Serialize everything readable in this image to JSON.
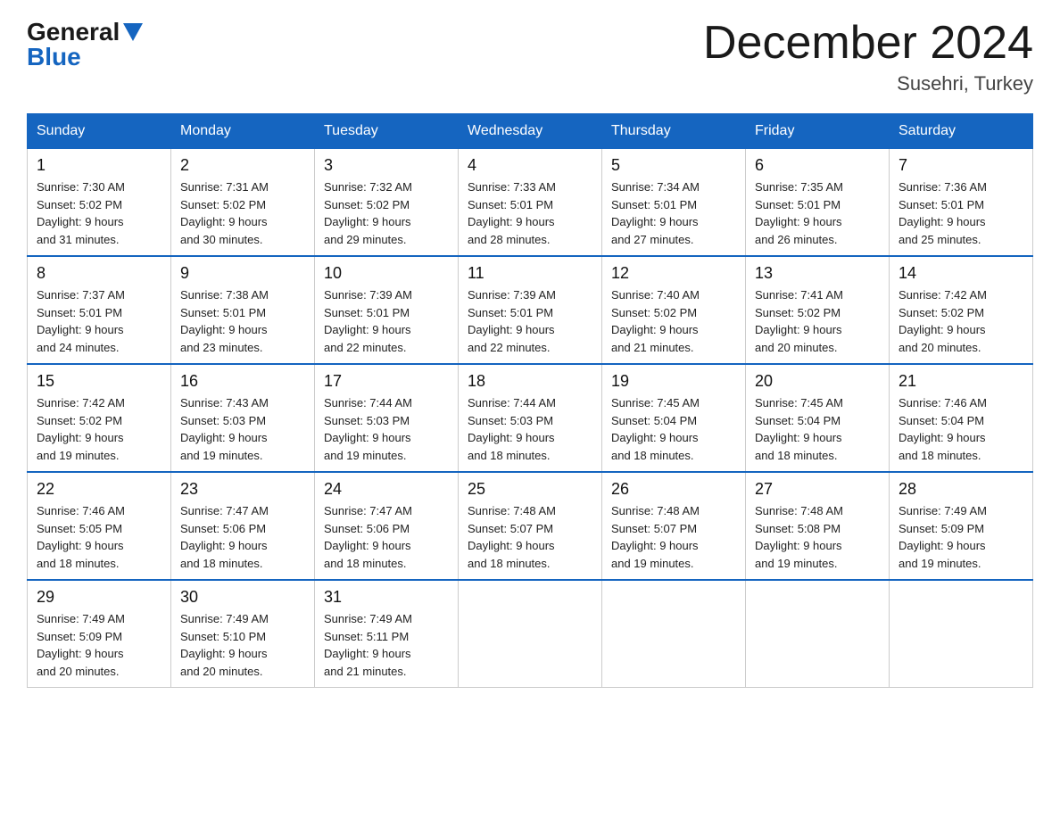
{
  "header": {
    "logo_general": "General",
    "logo_blue": "Blue",
    "month_title": "December 2024",
    "location": "Susehri, Turkey"
  },
  "days_of_week": [
    "Sunday",
    "Monday",
    "Tuesday",
    "Wednesday",
    "Thursday",
    "Friday",
    "Saturday"
  ],
  "weeks": [
    [
      {
        "day": "1",
        "sunrise": "7:30 AM",
        "sunset": "5:02 PM",
        "daylight": "9 hours and 31 minutes."
      },
      {
        "day": "2",
        "sunrise": "7:31 AM",
        "sunset": "5:02 PM",
        "daylight": "9 hours and 30 minutes."
      },
      {
        "day": "3",
        "sunrise": "7:32 AM",
        "sunset": "5:02 PM",
        "daylight": "9 hours and 29 minutes."
      },
      {
        "day": "4",
        "sunrise": "7:33 AM",
        "sunset": "5:01 PM",
        "daylight": "9 hours and 28 minutes."
      },
      {
        "day": "5",
        "sunrise": "7:34 AM",
        "sunset": "5:01 PM",
        "daylight": "9 hours and 27 minutes."
      },
      {
        "day": "6",
        "sunrise": "7:35 AM",
        "sunset": "5:01 PM",
        "daylight": "9 hours and 26 minutes."
      },
      {
        "day": "7",
        "sunrise": "7:36 AM",
        "sunset": "5:01 PM",
        "daylight": "9 hours and 25 minutes."
      }
    ],
    [
      {
        "day": "8",
        "sunrise": "7:37 AM",
        "sunset": "5:01 PM",
        "daylight": "9 hours and 24 minutes."
      },
      {
        "day": "9",
        "sunrise": "7:38 AM",
        "sunset": "5:01 PM",
        "daylight": "9 hours and 23 minutes."
      },
      {
        "day": "10",
        "sunrise": "7:39 AM",
        "sunset": "5:01 PM",
        "daylight": "9 hours and 22 minutes."
      },
      {
        "day": "11",
        "sunrise": "7:39 AM",
        "sunset": "5:01 PM",
        "daylight": "9 hours and 22 minutes."
      },
      {
        "day": "12",
        "sunrise": "7:40 AM",
        "sunset": "5:02 PM",
        "daylight": "9 hours and 21 minutes."
      },
      {
        "day": "13",
        "sunrise": "7:41 AM",
        "sunset": "5:02 PM",
        "daylight": "9 hours and 20 minutes."
      },
      {
        "day": "14",
        "sunrise": "7:42 AM",
        "sunset": "5:02 PM",
        "daylight": "9 hours and 20 minutes."
      }
    ],
    [
      {
        "day": "15",
        "sunrise": "7:42 AM",
        "sunset": "5:02 PM",
        "daylight": "9 hours and 19 minutes."
      },
      {
        "day": "16",
        "sunrise": "7:43 AM",
        "sunset": "5:03 PM",
        "daylight": "9 hours and 19 minutes."
      },
      {
        "day": "17",
        "sunrise": "7:44 AM",
        "sunset": "5:03 PM",
        "daylight": "9 hours and 19 minutes."
      },
      {
        "day": "18",
        "sunrise": "7:44 AM",
        "sunset": "5:03 PM",
        "daylight": "9 hours and 18 minutes."
      },
      {
        "day": "19",
        "sunrise": "7:45 AM",
        "sunset": "5:04 PM",
        "daylight": "9 hours and 18 minutes."
      },
      {
        "day": "20",
        "sunrise": "7:45 AM",
        "sunset": "5:04 PM",
        "daylight": "9 hours and 18 minutes."
      },
      {
        "day": "21",
        "sunrise": "7:46 AM",
        "sunset": "5:04 PM",
        "daylight": "9 hours and 18 minutes."
      }
    ],
    [
      {
        "day": "22",
        "sunrise": "7:46 AM",
        "sunset": "5:05 PM",
        "daylight": "9 hours and 18 minutes."
      },
      {
        "day": "23",
        "sunrise": "7:47 AM",
        "sunset": "5:06 PM",
        "daylight": "9 hours and 18 minutes."
      },
      {
        "day": "24",
        "sunrise": "7:47 AM",
        "sunset": "5:06 PM",
        "daylight": "9 hours and 18 minutes."
      },
      {
        "day": "25",
        "sunrise": "7:48 AM",
        "sunset": "5:07 PM",
        "daylight": "9 hours and 18 minutes."
      },
      {
        "day": "26",
        "sunrise": "7:48 AM",
        "sunset": "5:07 PM",
        "daylight": "9 hours and 19 minutes."
      },
      {
        "day": "27",
        "sunrise": "7:48 AM",
        "sunset": "5:08 PM",
        "daylight": "9 hours and 19 minutes."
      },
      {
        "day": "28",
        "sunrise": "7:49 AM",
        "sunset": "5:09 PM",
        "daylight": "9 hours and 19 minutes."
      }
    ],
    [
      {
        "day": "29",
        "sunrise": "7:49 AM",
        "sunset": "5:09 PM",
        "daylight": "9 hours and 20 minutes."
      },
      {
        "day": "30",
        "sunrise": "7:49 AM",
        "sunset": "5:10 PM",
        "daylight": "9 hours and 20 minutes."
      },
      {
        "day": "31",
        "sunrise": "7:49 AM",
        "sunset": "5:11 PM",
        "daylight": "9 hours and 21 minutes."
      },
      null,
      null,
      null,
      null
    ]
  ],
  "labels": {
    "sunrise": "Sunrise:",
    "sunset": "Sunset:",
    "daylight": "Daylight:"
  }
}
